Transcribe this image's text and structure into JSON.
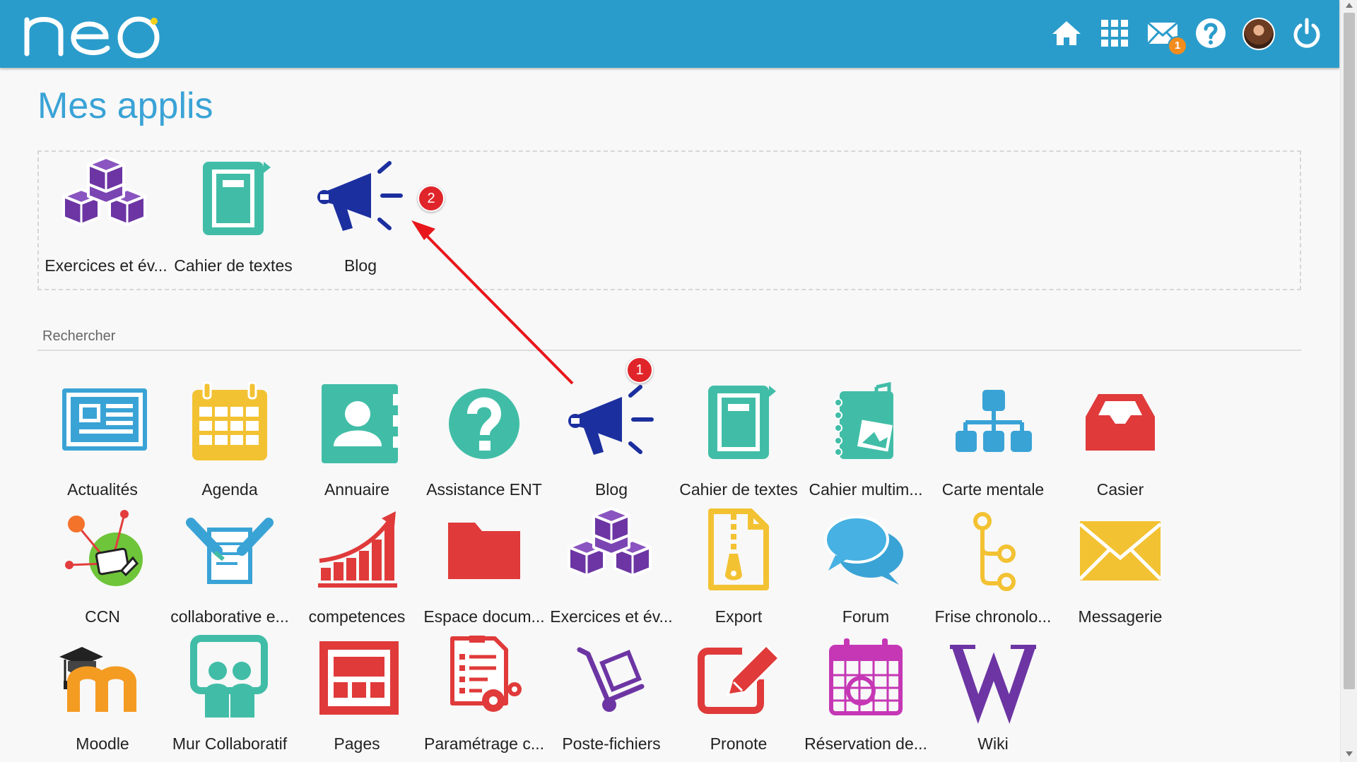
{
  "app": {
    "logo_text": "neo"
  },
  "header": {
    "icons": [
      "home-icon",
      "apps-grid-icon",
      "mail-icon",
      "help-icon",
      "avatar",
      "power-icon"
    ],
    "mail_count": "1"
  },
  "page": {
    "title": "Mes applis"
  },
  "favorites": [
    {
      "label": "Exercices et év...",
      "icon": "cubes-icon"
    },
    {
      "label": "Cahier de textes",
      "icon": "notebook-icon"
    },
    {
      "label": "Blog",
      "icon": "megaphone-icon"
    }
  ],
  "search": {
    "placeholder": "Rechercher"
  },
  "apps": [
    {
      "label": "Actualités",
      "icon": "newspaper-icon"
    },
    {
      "label": "Agenda",
      "icon": "calendar-icon"
    },
    {
      "label": "Annuaire",
      "icon": "address-book-icon"
    },
    {
      "label": "Assistance ENT",
      "icon": "question-icon"
    },
    {
      "label": "Blog",
      "icon": "megaphone-icon"
    },
    {
      "label": "Cahier de textes",
      "icon": "notebook-icon"
    },
    {
      "label": "Cahier multim...",
      "icon": "multimedia-notebook-icon"
    },
    {
      "label": "Carte mentale",
      "icon": "mindmap-icon"
    },
    {
      "label": "Casier",
      "icon": "inbox-tray-icon"
    },
    {
      "label": "CCN",
      "icon": "ccn-icon"
    },
    {
      "label": "collaborative e...",
      "icon": "collaborative-editor-icon"
    },
    {
      "label": "competences",
      "icon": "growth-chart-icon"
    },
    {
      "label": "Espace docum...",
      "icon": "folder-icon"
    },
    {
      "label": "Exercices et év...",
      "icon": "cubes-icon"
    },
    {
      "label": "Export",
      "icon": "zip-file-icon"
    },
    {
      "label": "Forum",
      "icon": "chat-bubbles-icon"
    },
    {
      "label": "Frise chronolo...",
      "icon": "timeline-icon"
    },
    {
      "label": "Messagerie",
      "icon": "envelope-icon"
    },
    {
      "label": "Moodle",
      "icon": "moodle-icon"
    },
    {
      "label": "Mur Collaboratif",
      "icon": "collaborative-wall-icon"
    },
    {
      "label": "Pages",
      "icon": "pages-icon"
    },
    {
      "label": "Paramétrage c...",
      "icon": "settings-document-icon"
    },
    {
      "label": "Poste-fichiers",
      "icon": "hand-truck-icon"
    },
    {
      "label": "Pronote",
      "icon": "edit-pencil-icon"
    },
    {
      "label": "Réservation de...",
      "icon": "booking-calendar-icon"
    },
    {
      "label": "Wiki",
      "icon": "wiki-icon"
    }
  ],
  "annotations": {
    "badge_1": "1",
    "badge_2": "2"
  },
  "colors": {
    "header": "#2a9ccb",
    "title": "#3aa3d6",
    "badge": "#e0252a",
    "arrow": "#e8161b"
  }
}
